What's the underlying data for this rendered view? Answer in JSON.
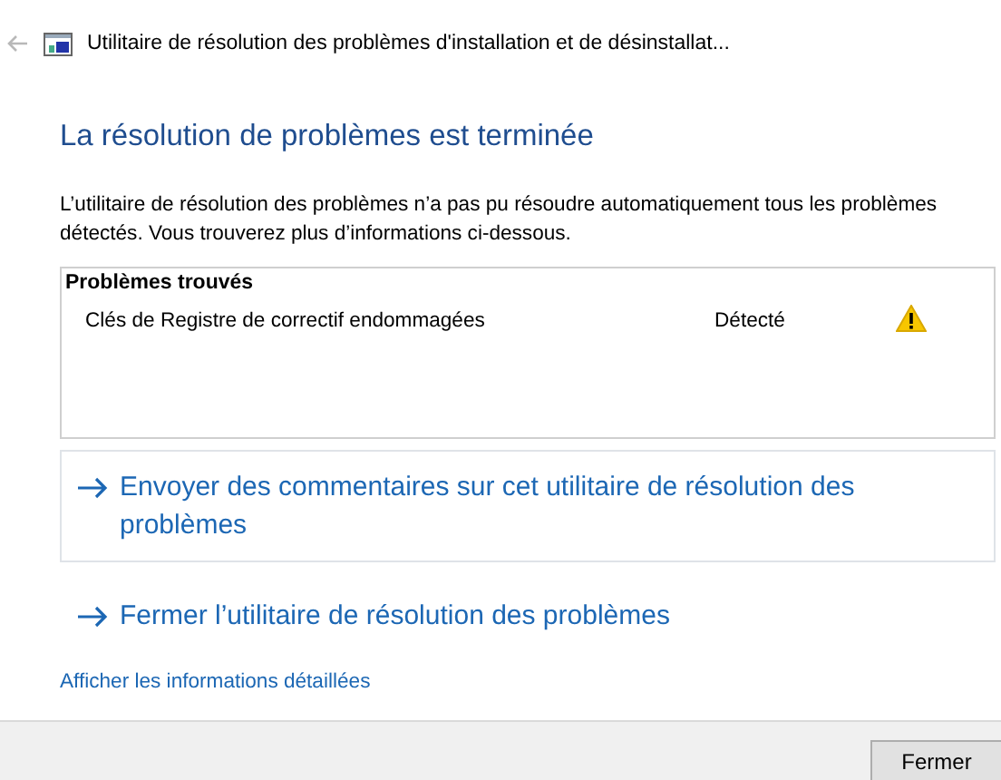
{
  "window": {
    "title": "Utilitaire de résolution des problèmes d'installation et de désinstallat..."
  },
  "heading": "La résolution de problèmes est terminée",
  "message": "L’utilitaire de résolution des problèmes n’a pas pu résoudre automatiquement tous les problèmes détectés. Vous trouverez plus d’informations ci-dessous.",
  "problems": {
    "title": "Problèmes trouvés",
    "items": [
      {
        "name": "Clés de Registre de correctif endommagées",
        "status": "Détecté",
        "kind": "warning"
      }
    ]
  },
  "actions": [
    {
      "label": "Envoyer des commentaires sur cet utilitaire de résolution des problèmes",
      "selected": true
    },
    {
      "label": "Fermer l’utilitaire de résolution des problèmes",
      "selected": false
    }
  ],
  "details_link": "Afficher les informations détaillées",
  "buttons": [
    "Fermer"
  ]
}
